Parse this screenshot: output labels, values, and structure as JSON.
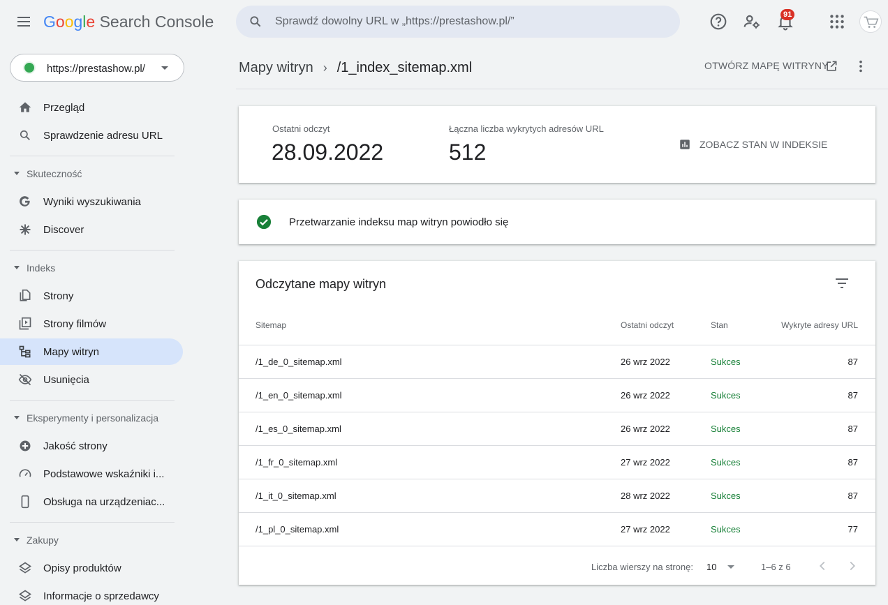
{
  "app": {
    "logo": {
      "g": "G",
      "o1": "o",
      "o2": "o",
      "g2": "g",
      "l": "l",
      "e": "e",
      "product": " Search Console"
    },
    "search_placeholder": "Sprawdź dowolny URL w „https://prestashow.pl/”",
    "notifications_count": "91"
  },
  "sidebar": {
    "property": "https://prestashow.pl/",
    "top_items": [
      {
        "label": "Przegląd",
        "icon": "home-icon"
      },
      {
        "label": "Sprawdzenie adresu URL",
        "icon": "search-icon"
      }
    ],
    "sections": [
      {
        "label": "Skuteczność",
        "items": [
          {
            "label": "Wyniki wyszukiwania",
            "icon": "google-g-icon"
          },
          {
            "label": "Discover",
            "icon": "asterisk-icon"
          }
        ]
      },
      {
        "label": "Indeks",
        "items": [
          {
            "label": "Strony",
            "icon": "pages-icon"
          },
          {
            "label": "Strony filmów",
            "icon": "video-pages-icon"
          },
          {
            "label": "Mapy witryn",
            "icon": "sitemap-icon",
            "active": true
          },
          {
            "label": "Usunięcia",
            "icon": "eye-off-icon"
          }
        ]
      },
      {
        "label": "Eksperymenty i personalizacja",
        "items": [
          {
            "label": "Jakość strony",
            "icon": "page-quality-icon"
          },
          {
            "label": "Podstawowe wskaźniki i...",
            "icon": "gauge-icon"
          },
          {
            "label": "Obsługa na urządzeniac...",
            "icon": "phone-icon"
          }
        ]
      },
      {
        "label": "Zakupy",
        "items": [
          {
            "label": "Opisy produktów",
            "icon": "layers-icon"
          },
          {
            "label": "Informacje o sprzedawcy",
            "icon": "layers-icon"
          }
        ]
      }
    ]
  },
  "main": {
    "breadcrumb": {
      "parent": "Mapy witryn",
      "current": "/1_index_sitemap.xml"
    },
    "open_sitemap_label": "OTWÓRZ MAPĘ WITRYNY",
    "summary": {
      "last_read_label": "Ostatni odczyt",
      "last_read_value": "28.09.2022",
      "urls_label": "Łączna liczba wykrytych adresów URL",
      "urls_value": "512",
      "index_status_label": "ZOBACZ STAN W INDEKSIE"
    },
    "status_message": "Przetwarzanie indeksu map witryn powiodło się",
    "table": {
      "title": "Odczytane mapy witryn",
      "columns": [
        "Sitemap",
        "Ostatni odczyt",
        "Stan",
        "Wykryte adresy URL"
      ],
      "rows": [
        [
          "/1_de_0_sitemap.xml",
          "26 wrz 2022",
          "Sukces",
          "87"
        ],
        [
          "/1_en_0_sitemap.xml",
          "26 wrz 2022",
          "Sukces",
          "87"
        ],
        [
          "/1_es_0_sitemap.xml",
          "26 wrz 2022",
          "Sukces",
          "87"
        ],
        [
          "/1_fr_0_sitemap.xml",
          "27 wrz 2022",
          "Sukces",
          "87"
        ],
        [
          "/1_it_0_sitemap.xml",
          "28 wrz 2022",
          "Sukces",
          "87"
        ],
        [
          "/1_pl_0_sitemap.xml",
          "27 wrz 2022",
          "Sukces",
          "77"
        ]
      ],
      "pager": {
        "rows_label": "Liczba wierszy na stronę:",
        "rows_value": "10",
        "range": "1–6 z 6"
      }
    }
  },
  "colors": {
    "accent": "#1a73e8",
    "success": "#188038",
    "active_nav": "#d6e4fb",
    "badge": "#d93025"
  }
}
